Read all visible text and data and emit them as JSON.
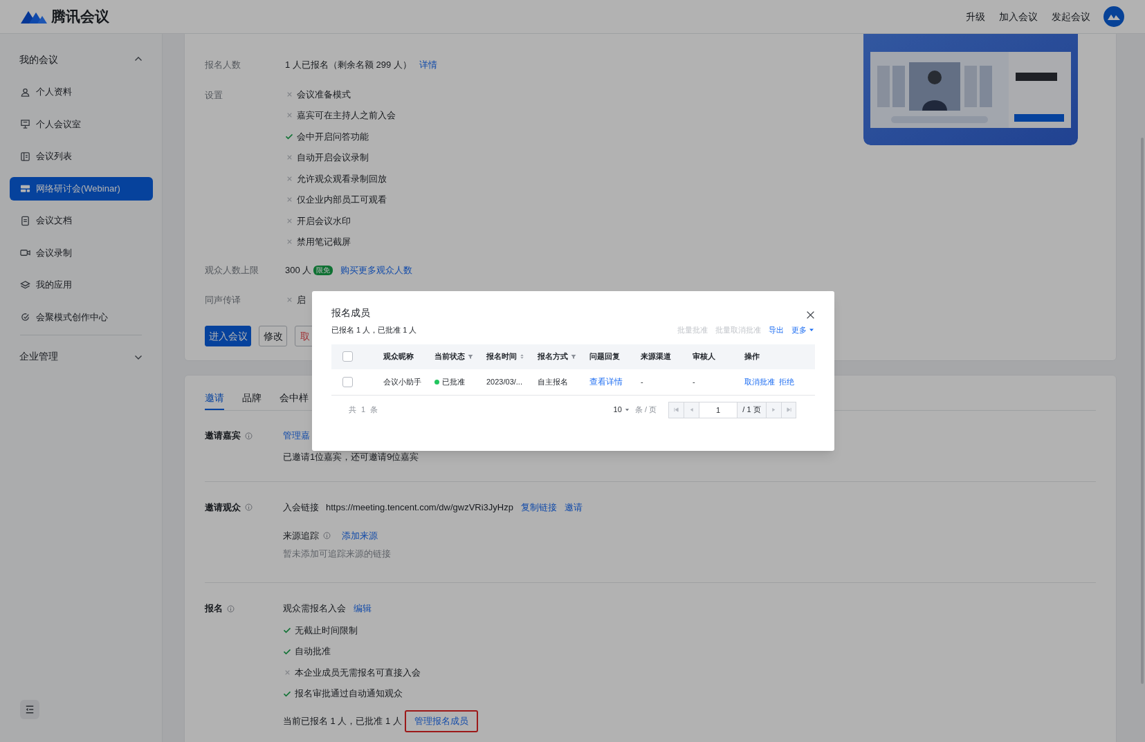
{
  "header": {
    "logo_text": "腾讯会议",
    "actions": [
      "升级",
      "加入会议",
      "发起会议"
    ]
  },
  "sidebar": {
    "groups": [
      {
        "label": "我的会议",
        "expanded": true,
        "items": [
          {
            "label": "个人资料",
            "selected": false
          },
          {
            "label": "个人会议室",
            "selected": false
          },
          {
            "label": "会议列表",
            "selected": false
          },
          {
            "label": "网络研讨会(Webinar)",
            "selected": true
          },
          {
            "label": "会议文档",
            "selected": false
          },
          {
            "label": "会议录制",
            "selected": false
          },
          {
            "label": "我的应用",
            "selected": false
          },
          {
            "label": "会聚模式创作中心",
            "selected": false
          }
        ]
      },
      {
        "label": "企业管理",
        "expanded": false
      }
    ]
  },
  "meeting": {
    "rows": [
      {
        "label": "报名人数",
        "value": "1 人已报名（剩余名额 299 人）",
        "link": "详情"
      }
    ],
    "settings": {
      "label": "设置",
      "items": [
        {
          "label": "会议准备模式",
          "on": false
        },
        {
          "label": "嘉宾可在主持人之前入会",
          "on": false
        },
        {
          "label": "会中开启问答功能",
          "on": true
        },
        {
          "label": "自动开启会议录制",
          "on": false
        },
        {
          "label": "允许观众观看录制回放",
          "on": false
        },
        {
          "label": "仅企业内部员工可观看",
          "on": false
        },
        {
          "label": "开启会议水印",
          "on": false
        },
        {
          "label": "禁用笔记截屏",
          "on": false
        }
      ]
    },
    "audience_limit": {
      "label": "观众人数上限",
      "value": "300 人",
      "badge": "限免",
      "link": "购买更多观众人数"
    },
    "interpretation": {
      "label": "同声传译",
      "items": [
        {
          "label": "启",
          "on": false
        }
      ]
    },
    "buttons": [
      {
        "label": "进入会议",
        "kind": "primary"
      },
      {
        "label": "修改",
        "kind": "default"
      },
      {
        "label": "取",
        "kind": "danger"
      }
    ]
  },
  "tabs": [
    {
      "label": "邀请",
      "selected": true
    },
    {
      "label": "品牌",
      "selected": false
    },
    {
      "label": "会中样",
      "selected": false
    }
  ],
  "invite_guests": {
    "label": "邀请嘉宾",
    "link": "管理嘉",
    "note": "已邀请1位嘉宾，还可邀请9位嘉宾"
  },
  "invite_audience": {
    "label": "邀请观众",
    "link_label": "入会链接",
    "url": "https://meeting.tencent.com/dw/gwzVRi3JyHzp",
    "actions": [
      "复制链接",
      "邀请"
    ],
    "tracking_label": "来源追踪",
    "tracking_action": "添加来源",
    "tracking_empty": "暂未添加可追踪来源的链接"
  },
  "registration": {
    "label": "报名",
    "mode": "观众需报名入会",
    "edit": "编辑",
    "items": [
      {
        "label": "无截止时间限制",
        "on": true
      },
      {
        "label": "自动批准",
        "on": true
      },
      {
        "label": "本企业成员无需报名可直接入会",
        "on": false
      },
      {
        "label": "报名审批通过自动通知观众",
        "on": true
      }
    ],
    "summary": "当前已报名 1 人，已批准 1 人",
    "manage": {
      "label": "管理报名成员",
      "highlighted": true
    }
  },
  "modal": {
    "title": "报名成员",
    "summary": "已报名 1 人，已批准 1 人",
    "actions": [
      {
        "label": "批量批准",
        "disabled": true,
        "kind": "plain"
      },
      {
        "label": "批量取消批准",
        "disabled": true,
        "kind": "plain"
      },
      {
        "label": "导出",
        "disabled": false,
        "kind": "plain"
      },
      {
        "label": "更多",
        "disabled": false,
        "kind": "dropdown"
      }
    ],
    "table": {
      "all_checked": false,
      "columns": [
        {
          "label": "观众昵称",
          "kind": "plain"
        },
        {
          "label": "当前状态",
          "kind": "filter"
        },
        {
          "label": "报名时间",
          "kind": "sort"
        },
        {
          "label": "报名方式",
          "kind": "filter"
        },
        {
          "label": "问题回复",
          "kind": "plain"
        },
        {
          "label": "来源渠道",
          "kind": "plain"
        },
        {
          "label": "审核人",
          "kind": "plain"
        },
        {
          "label": "操作",
          "kind": "plain"
        }
      ],
      "rows": [
        {
          "checked": false,
          "nickname": "会议小助手",
          "status": {
            "text": "已批准",
            "color": "#22c55e"
          },
          "time": "2023/03/...",
          "method": "自主报名",
          "reply": "查看详情",
          "source": "-",
          "reviewer": "-",
          "actions": [
            "取消批准",
            "拒绝"
          ]
        }
      ]
    },
    "footer": {
      "total": "共 1 条",
      "page_size": "10",
      "per_page": "条 / 页",
      "page": "1",
      "pages": "/ 1 页"
    }
  }
}
